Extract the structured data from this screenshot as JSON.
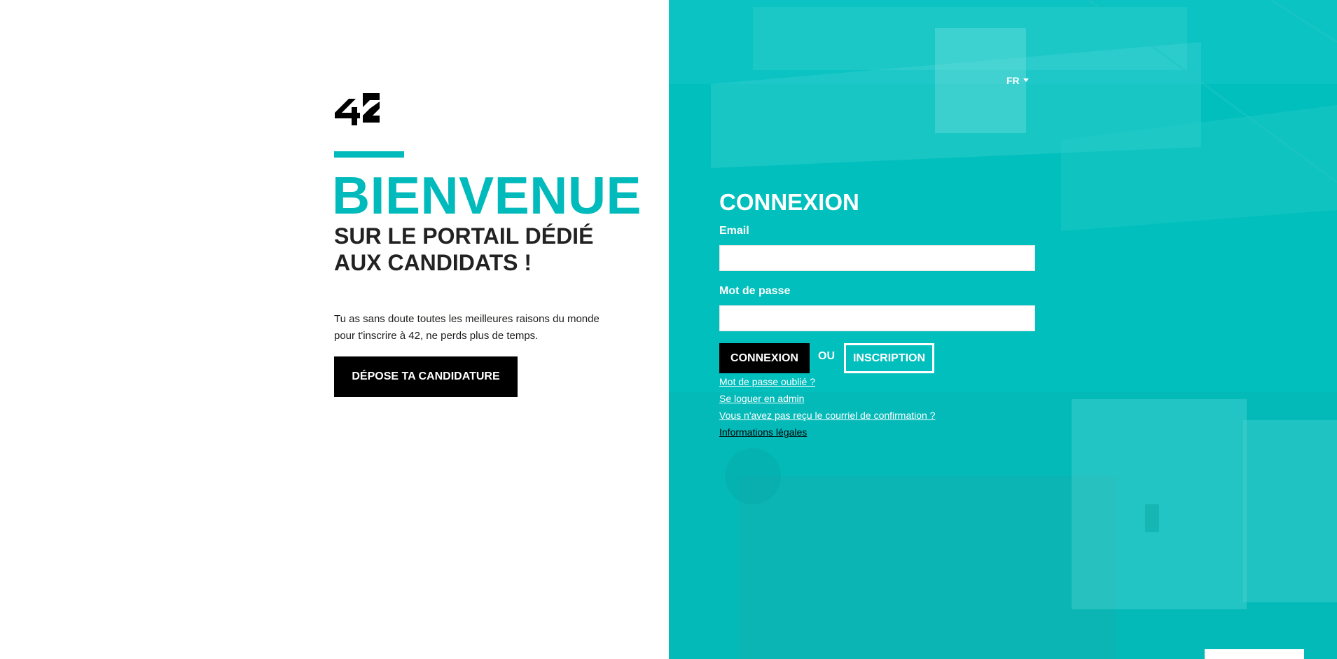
{
  "brand": {
    "logo_alt": "42",
    "accent_color": "#00babc",
    "panel_color": "#00bfbd"
  },
  "welcome": {
    "title": "BIENVENUE",
    "subtitle": "SUR LE PORTAIL DÉDIÉ AUX CANDIDATS !",
    "intro": "Tu as sans doute toutes les meilleures raisons du monde pour t'inscrire à 42, ne perds plus de temps.",
    "apply_button": "DÉPOSE TA CANDIDATURE"
  },
  "language": {
    "current": "FR",
    "icon": "caret-down-icon"
  },
  "login": {
    "title": "CONNEXION",
    "email_label": "Email",
    "email_value": "",
    "password_label": "Mot de passe",
    "password_value": "",
    "submit_button": "CONNEXION",
    "or_text": "OU",
    "signup_button": "INSCRIPTION"
  },
  "links": {
    "forgot_password": "Mot de passe oublié ?",
    "admin_login": "Se loguer en admin",
    "no_confirmation": "Vous n'avez pas reçu le courriel de confirmation ?",
    "legal": "Informations légales"
  }
}
